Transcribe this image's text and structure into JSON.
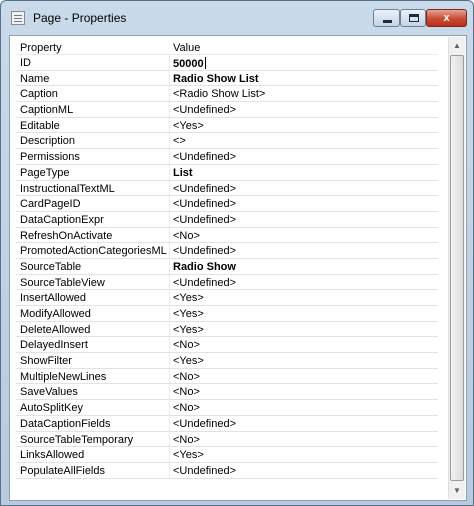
{
  "window": {
    "title": "Page - Properties",
    "close_glyph": "x"
  },
  "table": {
    "headers": {
      "property": "Property",
      "value": "Value"
    },
    "rows": [
      {
        "property": "ID",
        "value": "50000",
        "bold": true,
        "editing": true
      },
      {
        "property": "Name",
        "value": "Radio Show List",
        "bold": true
      },
      {
        "property": "Caption",
        "value": "<Radio Show List>"
      },
      {
        "property": "CaptionML",
        "value": "<Undefined>"
      },
      {
        "property": "Editable",
        "value": "<Yes>"
      },
      {
        "property": "Description",
        "value": "<>"
      },
      {
        "property": "Permissions",
        "value": "<Undefined>"
      },
      {
        "property": "PageType",
        "value": "List",
        "bold": true
      },
      {
        "property": "InstructionalTextML",
        "value": "<Undefined>"
      },
      {
        "property": "CardPageID",
        "value": "<Undefined>"
      },
      {
        "property": "DataCaptionExpr",
        "value": "<Undefined>"
      },
      {
        "property": "RefreshOnActivate",
        "value": "<No>"
      },
      {
        "property": "PromotedActionCategoriesML",
        "value": "<Undefined>"
      },
      {
        "property": "SourceTable",
        "value": "Radio Show",
        "bold": true
      },
      {
        "property": "SourceTableView",
        "value": "<Undefined>"
      },
      {
        "property": "InsertAllowed",
        "value": "<Yes>"
      },
      {
        "property": "ModifyAllowed",
        "value": "<Yes>"
      },
      {
        "property": "DeleteAllowed",
        "value": "<Yes>"
      },
      {
        "property": "DelayedInsert",
        "value": "<No>"
      },
      {
        "property": "ShowFilter",
        "value": "<Yes>"
      },
      {
        "property": "MultipleNewLines",
        "value": "<No>"
      },
      {
        "property": "SaveValues",
        "value": "<No>"
      },
      {
        "property": "AutoSplitKey",
        "value": "<No>"
      },
      {
        "property": "DataCaptionFields",
        "value": "<Undefined>"
      },
      {
        "property": "SourceTableTemporary",
        "value": "<No>"
      },
      {
        "property": "LinksAllowed",
        "value": "<Yes>"
      },
      {
        "property": "PopulateAllFields",
        "value": "<Undefined>"
      }
    ]
  },
  "icons": {
    "app": "properties-window-icon",
    "minimize": "minimize-icon",
    "maximize": "maximize-icon",
    "close": "close-icon",
    "scroll_up": "scroll-up-arrow-icon",
    "scroll_down": "scroll-down-arrow-icon"
  },
  "colors": {
    "titlebar": "#c4d6e8",
    "close_button": "#c94a32",
    "grid_line": "#e2e2e2"
  }
}
